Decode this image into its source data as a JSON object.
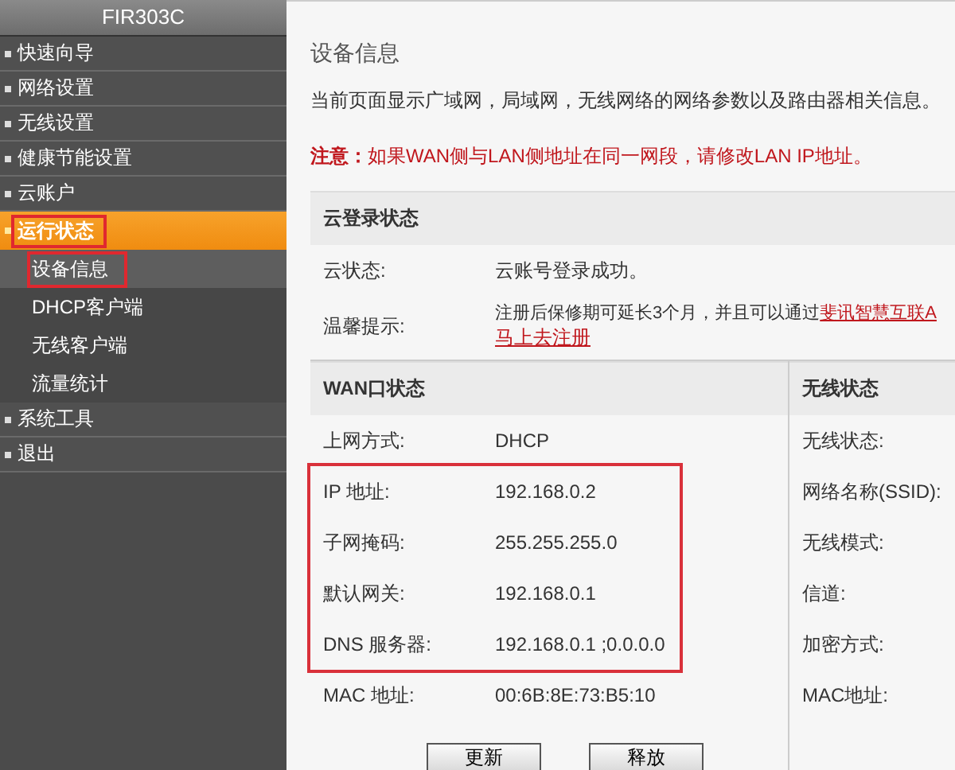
{
  "sidebar": {
    "title": "FIR303C",
    "items": [
      {
        "label": "快速向导",
        "selected": false,
        "highlighted": false
      },
      {
        "label": "网络设置",
        "selected": false,
        "highlighted": false
      },
      {
        "label": "无线设置",
        "selected": false,
        "highlighted": false
      },
      {
        "label": "健康节能设置",
        "selected": false,
        "highlighted": false
      },
      {
        "label": "云账户",
        "selected": false,
        "highlighted": false
      },
      {
        "label": "运行状态",
        "selected": true,
        "highlighted": true,
        "children": [
          {
            "label": "设备信息",
            "selected": true,
            "highlighted": true
          },
          {
            "label": "DHCP客户端",
            "selected": false,
            "highlighted": false
          },
          {
            "label": "无线客户端",
            "selected": false,
            "highlighted": false
          },
          {
            "label": "流量统计",
            "selected": false,
            "highlighted": false
          }
        ]
      },
      {
        "label": "系统工具",
        "selected": false,
        "highlighted": false
      },
      {
        "label": "退出",
        "selected": false,
        "highlighted": false
      }
    ]
  },
  "page": {
    "title": "设备信息",
    "description": "当前页面显示广域网，局域网，无线网络的网络参数以及路由器相关信息。",
    "notice": "**注意：**如果WAN侧与LAN侧地址在同一网段，请修改LAN IP地址。"
  },
  "cloud": {
    "title": "云登录状态",
    "status_label": "云状态:",
    "status_value": "云账号登录成功。",
    "tip_label": "温馨提示:",
    "tip_text": "注册后保修期可延长3个月，并且可以通过",
    "tip_link": "斐讯智慧互联A",
    "register_link": "马上去注册"
  },
  "wan": {
    "title": "WAN口状态",
    "rows": [
      {
        "label": "上网方式:",
        "value": "DHCP",
        "highlighted": false
      },
      {
        "label": "IP 地址:",
        "value": "192.168.0.2",
        "highlighted": true
      },
      {
        "label": "子网掩码:",
        "value": "255.255.255.0",
        "highlighted": true
      },
      {
        "label": "默认网关:",
        "value": "192.168.0.1",
        "highlighted": true
      },
      {
        "label": "DNS 服务器:",
        "value": "192.168.0.1 ;0.0.0.0",
        "highlighted": true
      },
      {
        "label": "MAC 地址:",
        "value": "00:6B:8E:73:B5:10",
        "highlighted": false
      }
    ],
    "buttons": [
      "更新",
      "释放"
    ]
  },
  "wireless": {
    "title": "无线状态",
    "rows": [
      "无线状态:",
      "网络名称(SSID):",
      "无线模式:",
      "信道:",
      "加密方式:",
      "MAC地址:"
    ]
  }
}
